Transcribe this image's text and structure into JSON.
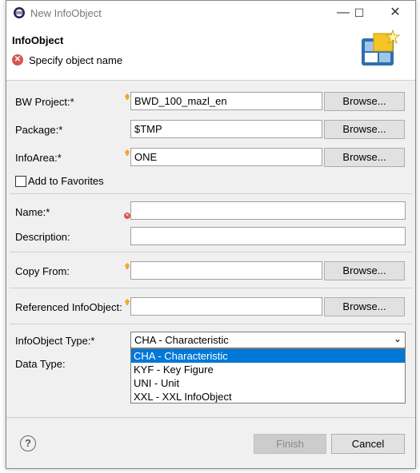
{
  "window": {
    "title": "New InfoObject"
  },
  "header": {
    "title": "InfoObject",
    "message": "Specify object name"
  },
  "form": {
    "bw_project": {
      "label": "BW Project:*",
      "value": "BWD_100_mazl_en",
      "browse": "Browse..."
    },
    "package": {
      "label": "Package:*",
      "value": "$TMP",
      "browse": "Browse..."
    },
    "infoarea": {
      "label": "InfoArea:*",
      "value": "ONE",
      "browse": "Browse..."
    },
    "favorites": {
      "label": "Add to Favorites",
      "checked": false
    },
    "name": {
      "label": "Name:*",
      "value": ""
    },
    "description": {
      "label": "Description:",
      "value": ""
    },
    "copy_from": {
      "label": "Copy From:",
      "value": "",
      "browse": "Browse..."
    },
    "referenced": {
      "label": "Referenced InfoObject:",
      "value": "",
      "browse": "Browse..."
    },
    "infoobject_type": {
      "label": "InfoObject Type:*",
      "selected": "CHA - Characteristic",
      "options": [
        "CHA - Characteristic",
        "KYF - Key Figure",
        "UNI - Unit",
        "XXL - XXL InfoObject"
      ]
    },
    "data_type": {
      "label": "Data Type:"
    }
  },
  "footer": {
    "help": "?",
    "finish": "Finish",
    "cancel": "Cancel"
  }
}
